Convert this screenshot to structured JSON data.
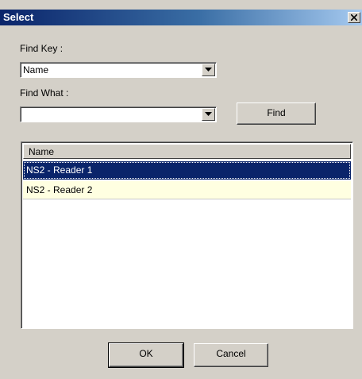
{
  "window": {
    "title": "Select",
    "close_label": "×"
  },
  "find_key": {
    "label": "Find Key :",
    "selected": "Name"
  },
  "find_what": {
    "label": "Find What :",
    "value": ""
  },
  "buttons": {
    "find": "Find",
    "ok": "OK",
    "cancel": "Cancel"
  },
  "list": {
    "column": "Name",
    "rows": [
      {
        "name": "NS2 - Reader 1",
        "selected": true
      },
      {
        "name": "NS2 - Reader 2",
        "selected": false
      }
    ]
  }
}
